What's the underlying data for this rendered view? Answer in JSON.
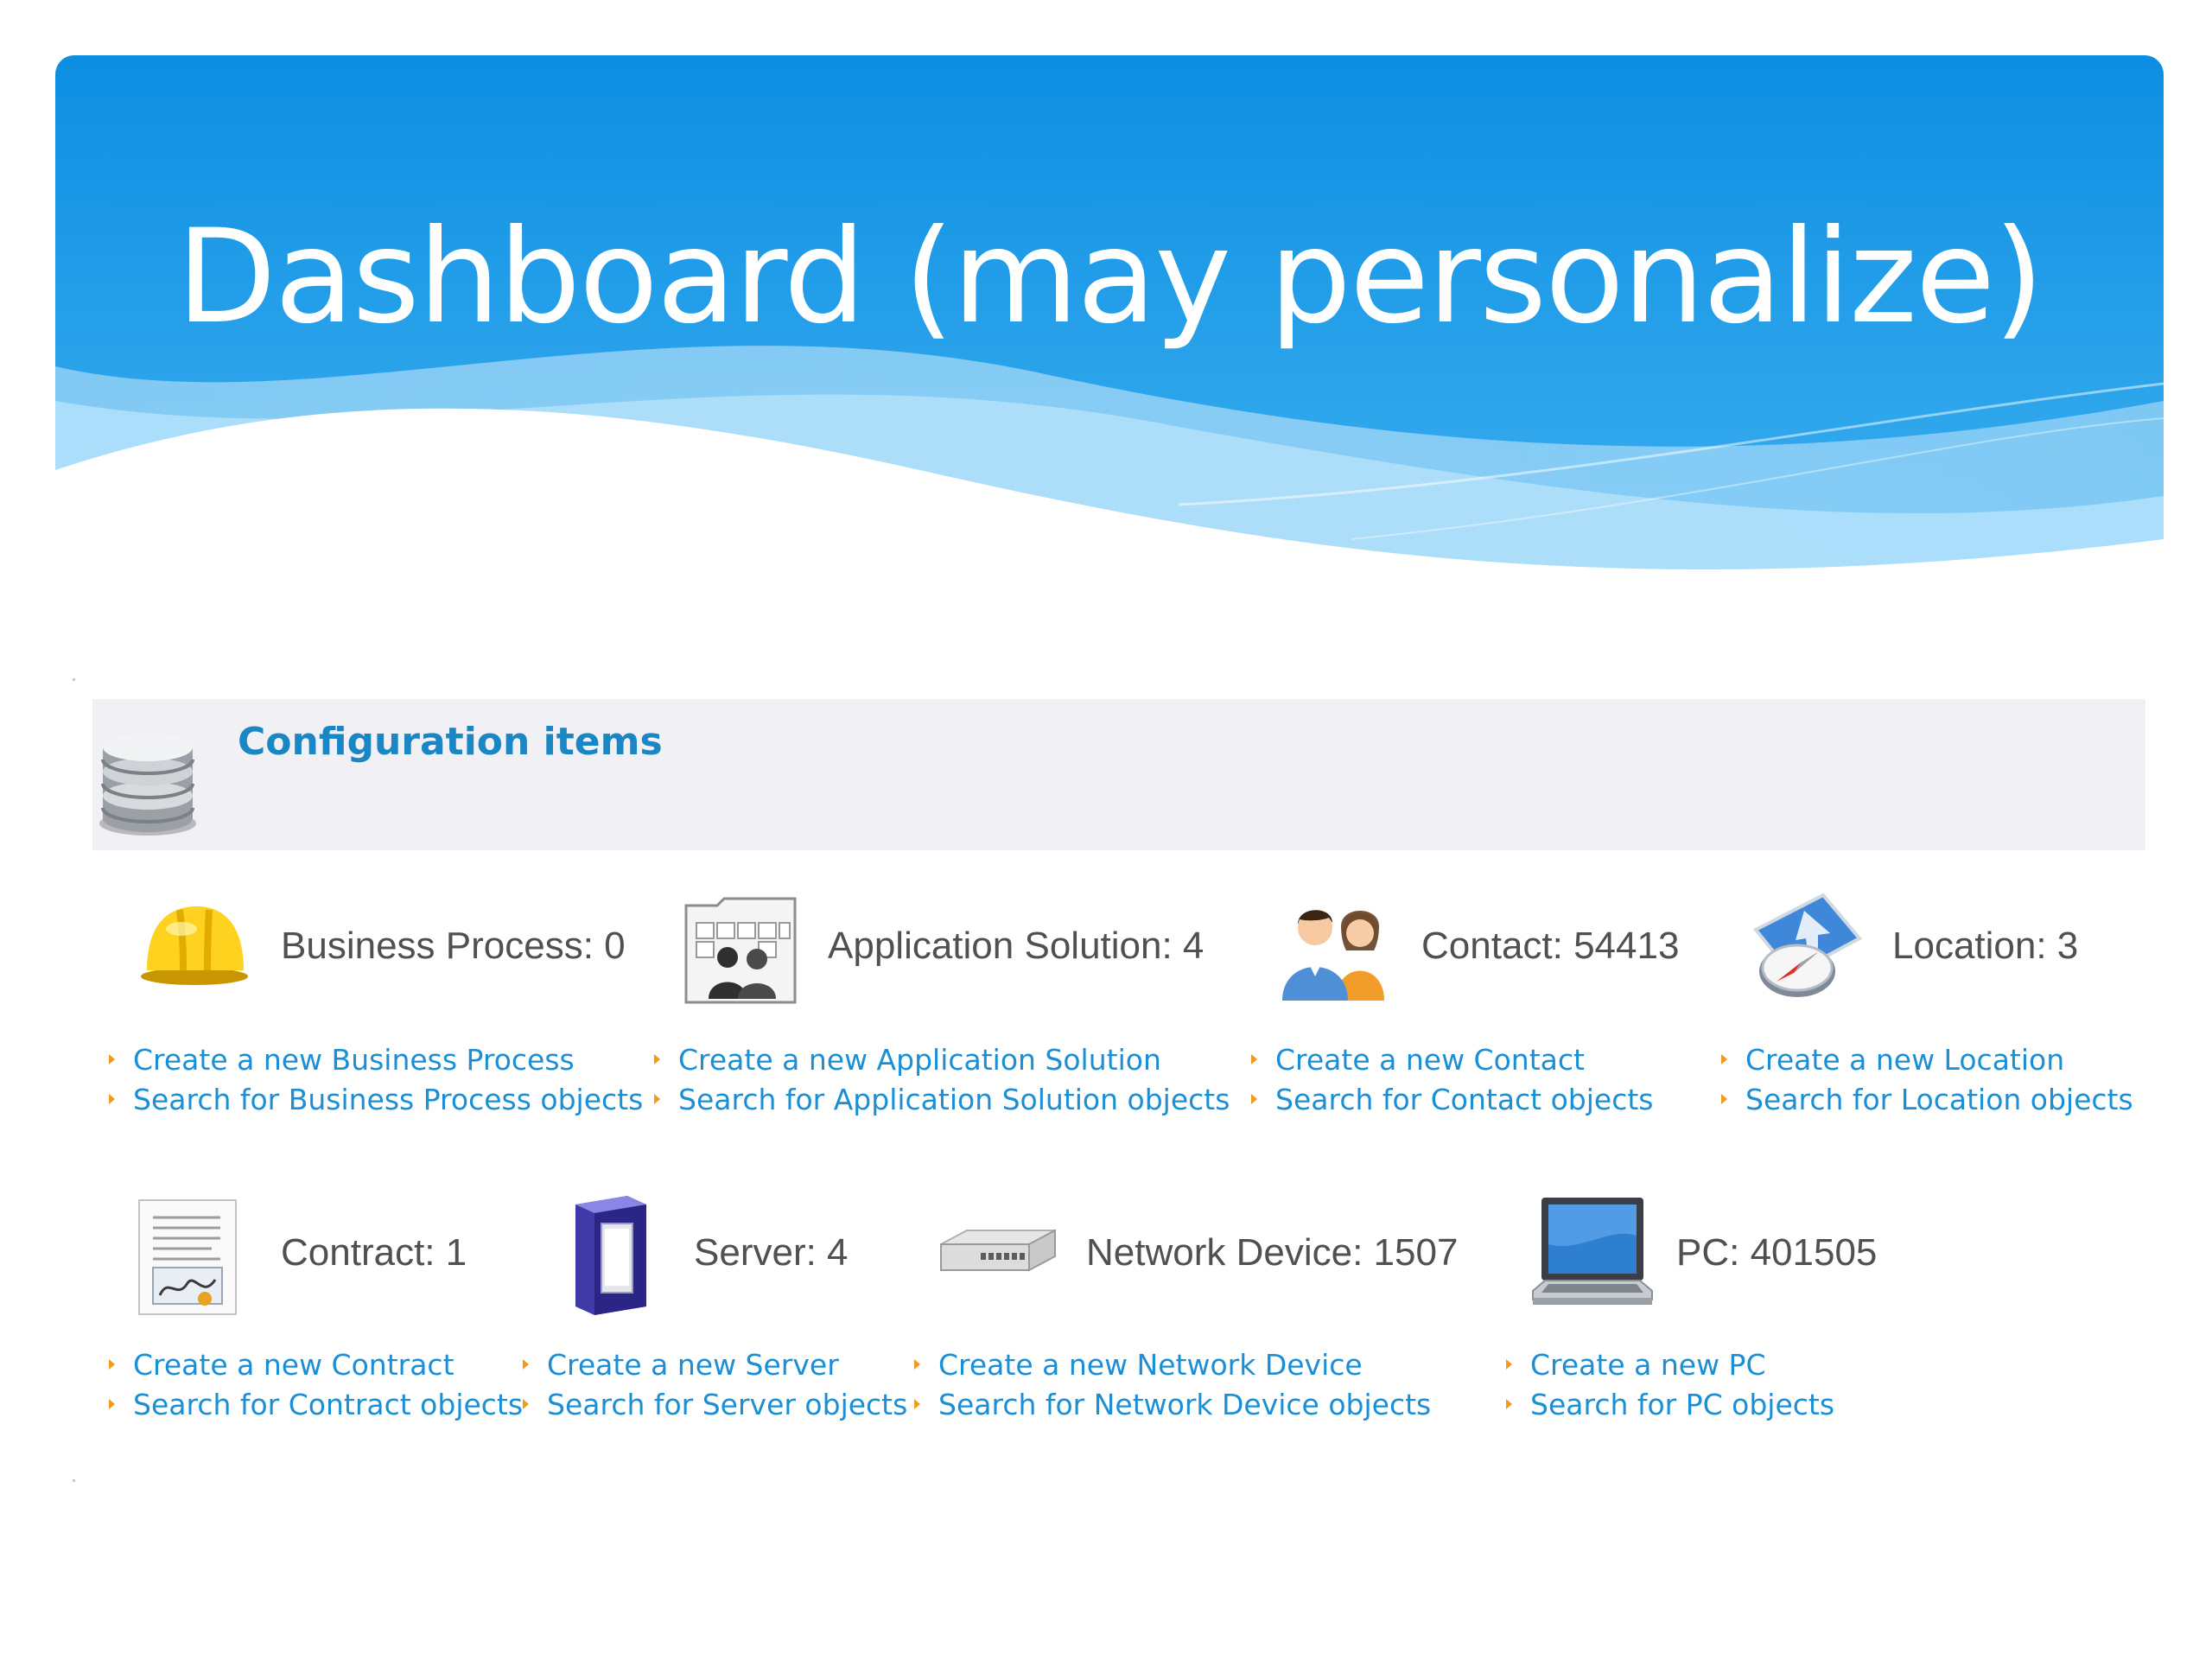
{
  "banner": {
    "title": "Dashboard (may personalize)",
    "colors": {
      "top": "#0d8ee2",
      "bottom": "#41b3f1",
      "wave_light": "#a9dcf9"
    }
  },
  "section": {
    "title": "Configuration items",
    "icon": "database-icon"
  },
  "items": [
    {
      "icon": "hard-hat-icon",
      "count_label": "Business Process: 0",
      "create_label": "Create a new Business Process",
      "search_label": "Search for Business Process objects"
    },
    {
      "icon": "application-solution-icon",
      "count_label": "Application Solution: 4",
      "create_label": "Create a new Application Solution",
      "search_label": "Search for Application Solution objects"
    },
    {
      "icon": "contacts-icon",
      "count_label": "Contact: 54413",
      "create_label": "Create a new Contact",
      "search_label": "Search for Contact objects"
    },
    {
      "icon": "location-compass-icon",
      "count_label": "Location: 3",
      "create_label": "Create a new Location",
      "search_label": "Search for Location objects"
    },
    {
      "icon": "contract-document-icon",
      "count_label": "Contract: 1",
      "create_label": "Create a new Contract",
      "search_label": "Search for Contract objects"
    },
    {
      "icon": "server-icon",
      "count_label": "Server: 4",
      "create_label": "Create a new Server",
      "search_label": "Search for Server objects"
    },
    {
      "icon": "network-switch-icon",
      "count_label": "Network Device: 1507",
      "create_label": "Create a new Network Device",
      "search_label": "Search for Network Device objects"
    },
    {
      "icon": "laptop-icon",
      "count_label": "PC: 401505",
      "create_label": "Create a new PC",
      "search_label": "Search for PC objects"
    }
  ],
  "colors": {
    "link": "#1a8fd6",
    "bullet": "#f29a1d",
    "section_title": "#1a86c4",
    "section_bg": "#f0f0f5",
    "count_text": "#505050"
  }
}
